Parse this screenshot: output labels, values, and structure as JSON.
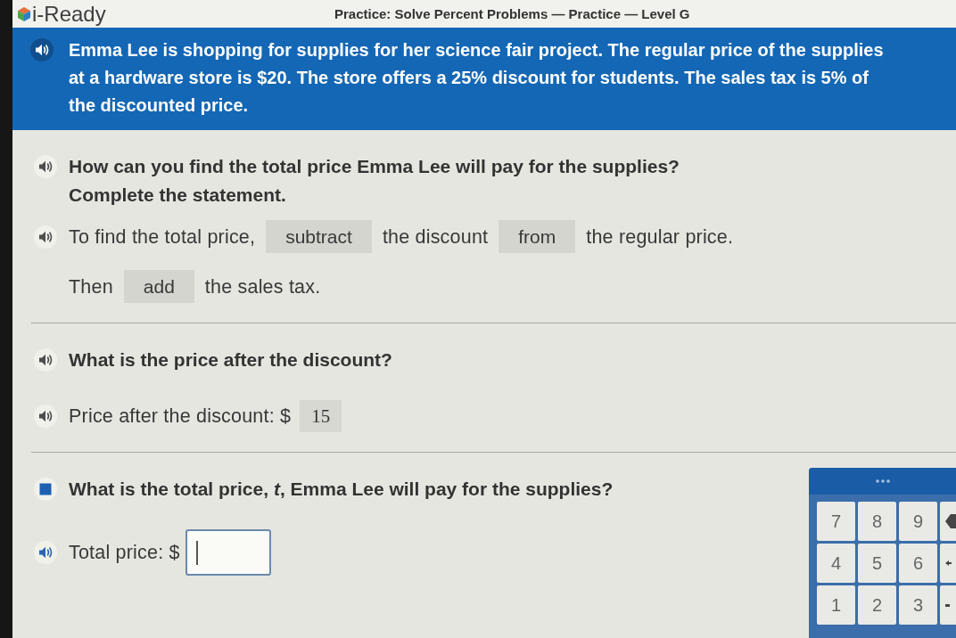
{
  "header": {
    "logo": "i-Ready",
    "title": "Practice: Solve Percent Problems — Practice — Level G"
  },
  "banner": {
    "speaker": {
      "playing": false
    },
    "text": "Emma Lee is shopping for supplies for her science fair project. The regular price of the supplies at a hardware store is $20. The store offers a 25% discount for students. The sales tax is 5% of the discounted price."
  },
  "sections": [
    {
      "rows": [
        {
          "kind": "question",
          "speaker": {
            "playing": false,
            "highlighted": false
          },
          "text": "How can you find the total price Emma Lee will pay for the supplies?"
        },
        {
          "kind": "instruction",
          "text": "Complete the statement."
        },
        {
          "kind": "fill",
          "speaker": {
            "playing": false,
            "highlighted": false
          },
          "parts": [
            {
              "kind": "text",
              "text": "To find the total price,"
            },
            {
              "kind": "choice",
              "value": "subtract"
            },
            {
              "kind": "text",
              "text": "the discount"
            },
            {
              "kind": "choice",
              "value": "from"
            },
            {
              "kind": "text",
              "text": "the regular price."
            }
          ]
        },
        {
          "kind": "fill",
          "parts": [
            {
              "kind": "text",
              "text": "Then"
            },
            {
              "kind": "choice",
              "value": "add"
            },
            {
              "kind": "text",
              "text": "the sales tax."
            }
          ]
        }
      ]
    },
    {
      "rows": [
        {
          "kind": "question",
          "speaker": {
            "playing": false,
            "highlighted": false
          },
          "text": "What is the price after the discount?"
        },
        {
          "kind": "fill",
          "speaker": {
            "playing": false,
            "highlighted": false
          },
          "parts": [
            {
              "kind": "text",
              "text": "Price after the discount: $"
            },
            {
              "kind": "entry",
              "value": "15"
            }
          ]
        }
      ]
    },
    {
      "rows": [
        {
          "kind": "question",
          "speaker": {
            "playing": true
          },
          "text": "What is the total price, *t*, Emma Lee will pay for the supplies?"
        },
        {
          "kind": "fill",
          "speaker": {
            "playing": false,
            "highlighted": true
          },
          "parts": [
            {
              "kind": "text",
              "text": "Total price: $"
            },
            {
              "kind": "input",
              "focused": true
            }
          ]
        }
      ]
    }
  ],
  "keypad": {
    "rows": [
      [
        {
          "kind": "digit",
          "label": "7"
        },
        {
          "kind": "digit",
          "label": "8"
        },
        {
          "kind": "digit",
          "label": "9"
        },
        {
          "kind": "backspace"
        }
      ],
      [
        {
          "kind": "digit",
          "label": "4"
        },
        {
          "kind": "digit",
          "label": "5"
        },
        {
          "kind": "digit",
          "label": "6"
        },
        {
          "kind": "left"
        }
      ],
      [
        {
          "kind": "digit",
          "label": "1"
        },
        {
          "kind": "digit",
          "label": "2"
        },
        {
          "kind": "digit",
          "label": "3"
        },
        {
          "kind": "minus"
        }
      ]
    ]
  }
}
